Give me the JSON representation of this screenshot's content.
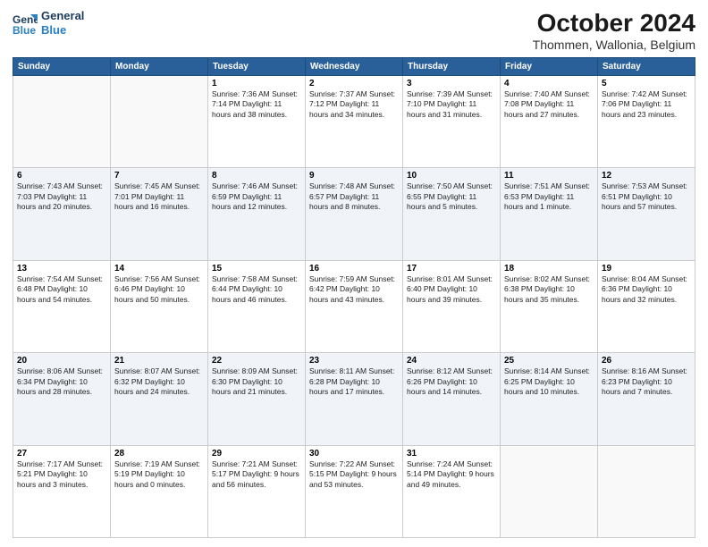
{
  "header": {
    "logo_line1": "General",
    "logo_line2": "Blue",
    "month": "October 2024",
    "location": "Thommen, Wallonia, Belgium"
  },
  "days_of_week": [
    "Sunday",
    "Monday",
    "Tuesday",
    "Wednesday",
    "Thursday",
    "Friday",
    "Saturday"
  ],
  "weeks": [
    [
      {
        "day": "",
        "info": ""
      },
      {
        "day": "",
        "info": ""
      },
      {
        "day": "1",
        "info": "Sunrise: 7:36 AM\nSunset: 7:14 PM\nDaylight: 11 hours and 38 minutes."
      },
      {
        "day": "2",
        "info": "Sunrise: 7:37 AM\nSunset: 7:12 PM\nDaylight: 11 hours and 34 minutes."
      },
      {
        "day": "3",
        "info": "Sunrise: 7:39 AM\nSunset: 7:10 PM\nDaylight: 11 hours and 31 minutes."
      },
      {
        "day": "4",
        "info": "Sunrise: 7:40 AM\nSunset: 7:08 PM\nDaylight: 11 hours and 27 minutes."
      },
      {
        "day": "5",
        "info": "Sunrise: 7:42 AM\nSunset: 7:06 PM\nDaylight: 11 hours and 23 minutes."
      }
    ],
    [
      {
        "day": "6",
        "info": "Sunrise: 7:43 AM\nSunset: 7:03 PM\nDaylight: 11 hours and 20 minutes."
      },
      {
        "day": "7",
        "info": "Sunrise: 7:45 AM\nSunset: 7:01 PM\nDaylight: 11 hours and 16 minutes."
      },
      {
        "day": "8",
        "info": "Sunrise: 7:46 AM\nSunset: 6:59 PM\nDaylight: 11 hours and 12 minutes."
      },
      {
        "day": "9",
        "info": "Sunrise: 7:48 AM\nSunset: 6:57 PM\nDaylight: 11 hours and 8 minutes."
      },
      {
        "day": "10",
        "info": "Sunrise: 7:50 AM\nSunset: 6:55 PM\nDaylight: 11 hours and 5 minutes."
      },
      {
        "day": "11",
        "info": "Sunrise: 7:51 AM\nSunset: 6:53 PM\nDaylight: 11 hours and 1 minute."
      },
      {
        "day": "12",
        "info": "Sunrise: 7:53 AM\nSunset: 6:51 PM\nDaylight: 10 hours and 57 minutes."
      }
    ],
    [
      {
        "day": "13",
        "info": "Sunrise: 7:54 AM\nSunset: 6:48 PM\nDaylight: 10 hours and 54 minutes."
      },
      {
        "day": "14",
        "info": "Sunrise: 7:56 AM\nSunset: 6:46 PM\nDaylight: 10 hours and 50 minutes."
      },
      {
        "day": "15",
        "info": "Sunrise: 7:58 AM\nSunset: 6:44 PM\nDaylight: 10 hours and 46 minutes."
      },
      {
        "day": "16",
        "info": "Sunrise: 7:59 AM\nSunset: 6:42 PM\nDaylight: 10 hours and 43 minutes."
      },
      {
        "day": "17",
        "info": "Sunrise: 8:01 AM\nSunset: 6:40 PM\nDaylight: 10 hours and 39 minutes."
      },
      {
        "day": "18",
        "info": "Sunrise: 8:02 AM\nSunset: 6:38 PM\nDaylight: 10 hours and 35 minutes."
      },
      {
        "day": "19",
        "info": "Sunrise: 8:04 AM\nSunset: 6:36 PM\nDaylight: 10 hours and 32 minutes."
      }
    ],
    [
      {
        "day": "20",
        "info": "Sunrise: 8:06 AM\nSunset: 6:34 PM\nDaylight: 10 hours and 28 minutes."
      },
      {
        "day": "21",
        "info": "Sunrise: 8:07 AM\nSunset: 6:32 PM\nDaylight: 10 hours and 24 minutes."
      },
      {
        "day": "22",
        "info": "Sunrise: 8:09 AM\nSunset: 6:30 PM\nDaylight: 10 hours and 21 minutes."
      },
      {
        "day": "23",
        "info": "Sunrise: 8:11 AM\nSunset: 6:28 PM\nDaylight: 10 hours and 17 minutes."
      },
      {
        "day": "24",
        "info": "Sunrise: 8:12 AM\nSunset: 6:26 PM\nDaylight: 10 hours and 14 minutes."
      },
      {
        "day": "25",
        "info": "Sunrise: 8:14 AM\nSunset: 6:25 PM\nDaylight: 10 hours and 10 minutes."
      },
      {
        "day": "26",
        "info": "Sunrise: 8:16 AM\nSunset: 6:23 PM\nDaylight: 10 hours and 7 minutes."
      }
    ],
    [
      {
        "day": "27",
        "info": "Sunrise: 7:17 AM\nSunset: 5:21 PM\nDaylight: 10 hours and 3 minutes."
      },
      {
        "day": "28",
        "info": "Sunrise: 7:19 AM\nSunset: 5:19 PM\nDaylight: 10 hours and 0 minutes."
      },
      {
        "day": "29",
        "info": "Sunrise: 7:21 AM\nSunset: 5:17 PM\nDaylight: 9 hours and 56 minutes."
      },
      {
        "day": "30",
        "info": "Sunrise: 7:22 AM\nSunset: 5:15 PM\nDaylight: 9 hours and 53 minutes."
      },
      {
        "day": "31",
        "info": "Sunrise: 7:24 AM\nSunset: 5:14 PM\nDaylight: 9 hours and 49 minutes."
      },
      {
        "day": "",
        "info": ""
      },
      {
        "day": "",
        "info": ""
      }
    ]
  ]
}
